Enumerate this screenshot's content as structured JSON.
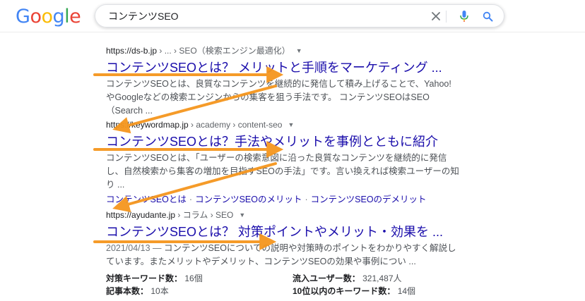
{
  "header": {
    "logo_letters": [
      "G",
      "o",
      "o",
      "g",
      "l",
      "e"
    ],
    "logo_colors": [
      "#4285F4",
      "#EA4335",
      "#FBBC05",
      "#4285F4",
      "#34A853",
      "#EA4335"
    ],
    "search_value": "コンテンツSEO",
    "icons": [
      "close-icon",
      "microphone-icon",
      "search-icon"
    ]
  },
  "results": [
    {
      "site": "https://ds-b.jp",
      "crumbs": " › ... › SEO（検索エンジン最適化）",
      "title": "コンテンツSEOとは？ メリットと手順をマーケティング ...",
      "snippet": "コンテンツSEOとは、良質なコンテンツを継続的に発信して積み上げることで、Yahoo!やGoogleなどの検索エンジンからの集客を狙う手法です。 コンテンツSEOはSEO（Search ..."
    },
    {
      "site": "https://keywordmap.jp",
      "crumbs": " › academy › content-seo",
      "title": "コンテンツSEOとは？手法やメリットを事例とともに紹介",
      "snippet": "コンテンツSEOとは、「ユーザーの検索意図に沿った良質なコンテンツを継続的に発信し、自然検索から集客の増加を目指すSEOの手法」です。言い換えれば検索ユーザーの知り ...",
      "sitelinks": [
        "コンテンツSEOとは",
        "コンテンツSEOのメリット",
        "コンテンツSEOのデメリット"
      ],
      "sitelink_separator": "·"
    },
    {
      "site": "https://ayudante.jp",
      "crumbs": " › コラム › SEO",
      "title": "コンテンツSEOとは？ 対策ポイントやメリット・効果を ...",
      "date": "2021/04/13 — ",
      "snippet": "コンテンツSEOについての説明や対策時のポイントをわかりやすく解説しています。またメリットやデメリット、コンテンツSEOの効果や事例につい ..."
    }
  ],
  "stats": {
    "keywords_label": "対策キーワード数：",
    "keywords_value": "16個",
    "articles_label": "記事本数：",
    "articles_value": "10本",
    "users_label": "流入ユーザー数：",
    "users_value": "321,487人",
    "top10_label": "10位以内のキーワード数：",
    "top10_value": "14個"
  },
  "colors": {
    "link": "#1a0dab",
    "arrow": "#F5961E",
    "snippet": "#4d5156"
  }
}
